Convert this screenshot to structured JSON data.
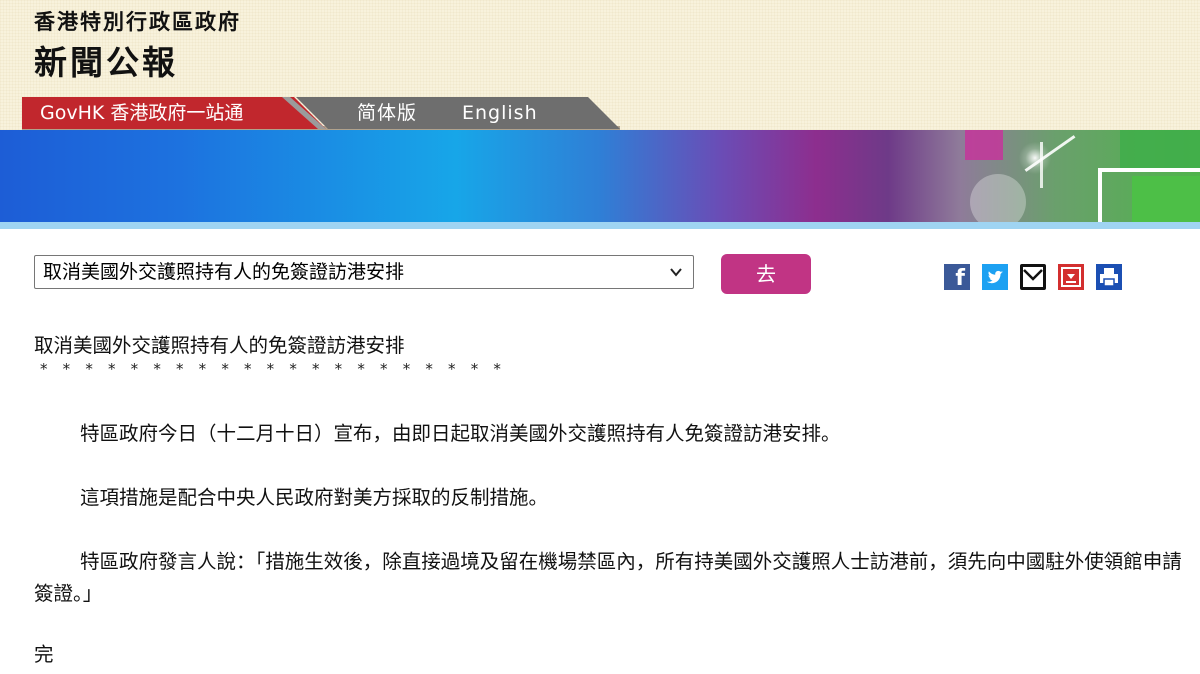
{
  "header": {
    "gov_name": "香港特別行政區政府",
    "press_title": "新聞公報"
  },
  "nav": {
    "govhk": "GovHK 香港政府一站通",
    "simplified": "简体版",
    "english": "English"
  },
  "toolbar": {
    "selected_article": "取消美國外交護照持有人的免簽證訪港安排",
    "go_label": "去",
    "facebook_glyph": "f"
  },
  "article": {
    "title": "取消美國外交護照持有人的免簽證訪港安排",
    "separator": "* * * * * * * * * * * * * * * * * * * * *",
    "paragraphs": [
      "特區政府今日（十二月十日）宣布，由即日起取消美國外交護照持有人免簽證訪港安排。",
      "這項措施是配合中央人民政府對美方採取的反制措施。",
      "特區政府發言人說：「措施生效後，除直接過境及留在機場禁區內，所有持美國外交護照人士訪港前，須先向中國駐外使領館申請簽證。」"
    ],
    "end": "完"
  },
  "colors": {
    "govhk_tab": "#c1272d",
    "lang_tab": "#6e6e6e",
    "go_button": "#c13484",
    "header_bg": "#f8f2dc"
  },
  "icons": [
    "facebook-icon",
    "twitter-icon",
    "email-icon",
    "pdf-download-icon",
    "print-icon"
  ]
}
